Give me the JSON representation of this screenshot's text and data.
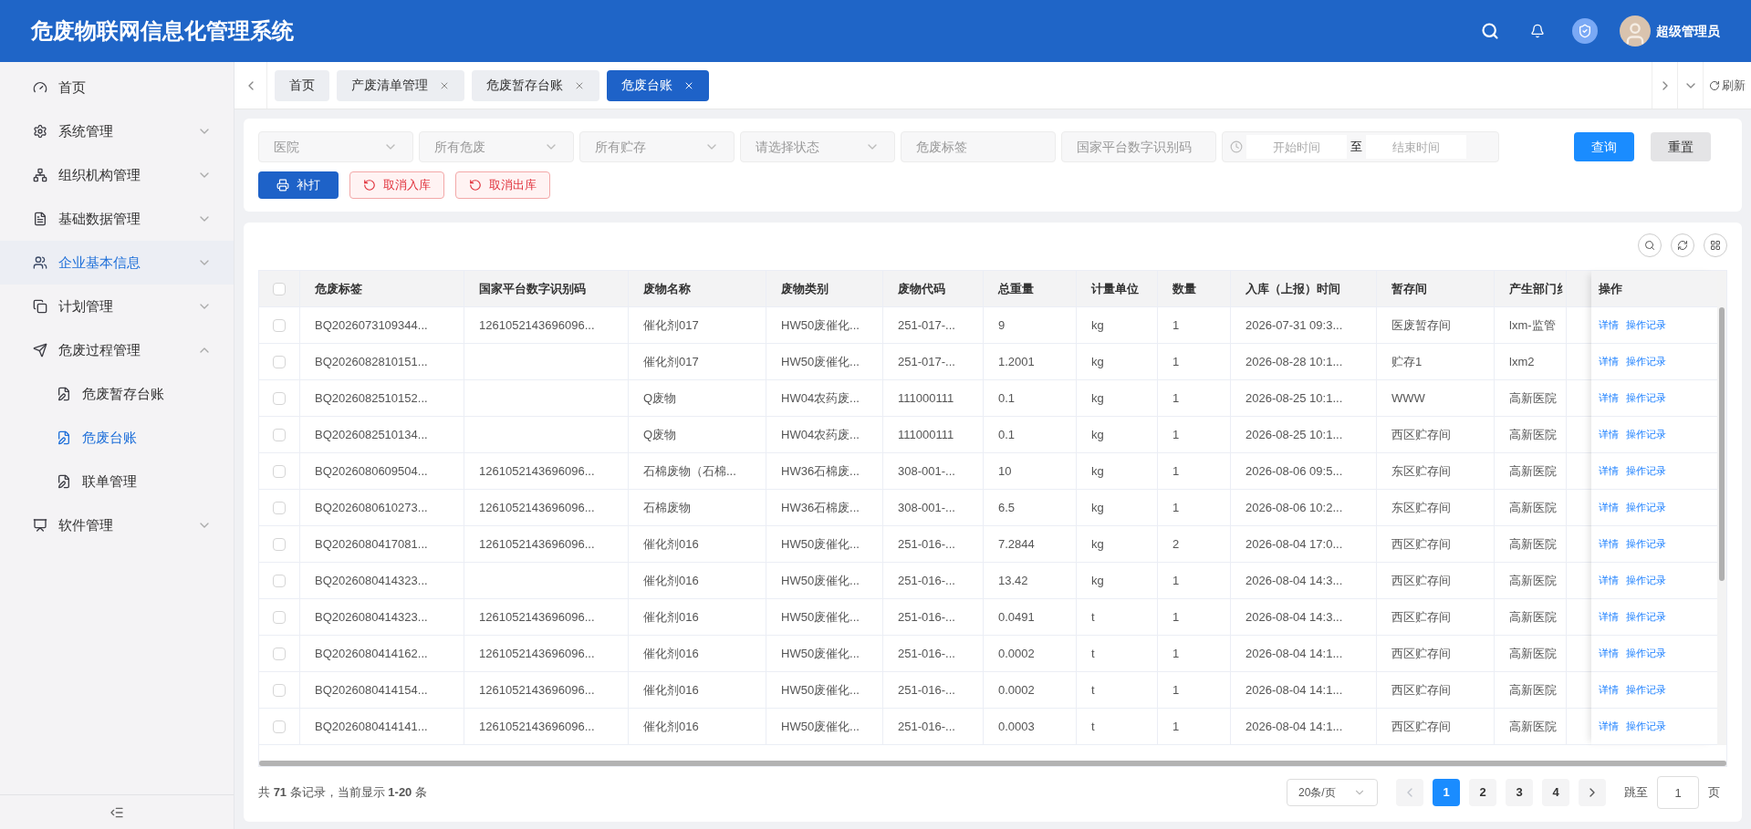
{
  "header": {
    "title": "危废物联网信息化管理系统",
    "user": "超级管理员"
  },
  "sidebar": {
    "items": [
      {
        "label": "首页",
        "kind": "link",
        "highlighted": false
      },
      {
        "label": "系统管理",
        "kind": "group",
        "expanded": false,
        "highlighted": false
      },
      {
        "label": "组织机构管理",
        "kind": "group",
        "expanded": false,
        "highlighted": false
      },
      {
        "label": "基础数据管理",
        "kind": "group",
        "expanded": false,
        "highlighted": false
      },
      {
        "label": "企业基本信息",
        "kind": "group",
        "expanded": false,
        "highlighted": true
      },
      {
        "label": "计划管理",
        "kind": "group",
        "expanded": false,
        "highlighted": false
      },
      {
        "label": "危废过程管理",
        "kind": "group",
        "expanded": true,
        "highlighted": false,
        "children": [
          {
            "label": "危废暂存台账",
            "selected": false
          },
          {
            "label": "危废台账",
            "selected": true
          },
          {
            "label": "联单管理",
            "selected": false
          }
        ]
      },
      {
        "label": "软件管理",
        "kind": "group",
        "expanded": false,
        "highlighted": false
      }
    ]
  },
  "tabs": [
    {
      "label": "首页",
      "selected": false,
      "closable": false
    },
    {
      "label": "产废清单管理",
      "selected": false,
      "closable": true
    },
    {
      "label": "危废暂存台账",
      "selected": false,
      "closable": true
    },
    {
      "label": "危废台账",
      "selected": true,
      "closable": true
    }
  ],
  "tabs_refresh": "刷新",
  "filters": [
    {
      "kind": "select",
      "placeholder": "医院"
    },
    {
      "kind": "select",
      "placeholder": "所有危废"
    },
    {
      "kind": "select",
      "placeholder": "所有贮存"
    },
    {
      "kind": "select",
      "placeholder": "请选择状态"
    },
    {
      "kind": "input",
      "placeholder": "危废标签"
    },
    {
      "kind": "input",
      "placeholder": "国家平台数字识别码"
    }
  ],
  "date_range": {
    "start_placeholder": "开始时间",
    "separator": "至",
    "end_placeholder": "结束时间"
  },
  "search_buttons": [
    {
      "label": "查询",
      "kind": "primary"
    },
    {
      "label": "重置",
      "kind": "default"
    }
  ],
  "action_buttons": [
    {
      "label": "补打",
      "kind": "primary"
    },
    {
      "label": "取消入库",
      "kind": "danger"
    },
    {
      "label": "取消出库",
      "kind": "danger"
    }
  ],
  "table": {
    "all_checked": false,
    "columns": [
      "危废标签",
      "国家平台数字识别码",
      "废物名称",
      "废物类别",
      "废物代码",
      "总重量",
      "计量单位",
      "数量",
      "入库（上报）时间",
      "暂存间",
      "产生部门纟"
    ],
    "action_column": "操作",
    "rows": [
      {
        "checked": false,
        "cells": [
          "BQ2026073109344...",
          "1261052143696096...",
          "催化剂017",
          "HW50废催化...",
          "251-017-...",
          "9",
          "kg",
          "1",
          "2026-07-31 09:3...",
          "医废暂存间",
          "lxm-监管"
        ],
        "actions": [
          "详情",
          "操作记录"
        ]
      },
      {
        "checked": false,
        "cells": [
          "BQ2026082810151...",
          null,
          "催化剂017",
          "HW50废催化...",
          "251-017-...",
          "1.2001",
          "kg",
          "1",
          "2026-08-28 10:1...",
          "贮存1",
          "lxm2"
        ],
        "actions": [
          "详情",
          "操作记录"
        ]
      },
      {
        "checked": false,
        "cells": [
          "BQ2026082510152...",
          null,
          "Q废物",
          "HW04农药废...",
          "111000111",
          "0.1",
          "kg",
          "1",
          "2026-08-25 10:1...",
          "WWW",
          "高新医院"
        ],
        "actions": [
          "详情",
          "操作记录"
        ]
      },
      {
        "checked": false,
        "cells": [
          "BQ2026082510134...",
          null,
          "Q废物",
          "HW04农药废...",
          "111000111",
          "0.1",
          "kg",
          "1",
          "2026-08-25 10:1...",
          "西区贮存间",
          "高新医院"
        ],
        "actions": [
          "详情",
          "操作记录"
        ]
      },
      {
        "checked": false,
        "cells": [
          "BQ2026080609504...",
          "1261052143696096...",
          "石棉废物（石棉...",
          "HW36石棉废...",
          "308-001-...",
          "10",
          "kg",
          "1",
          "2026-08-06 09:5...",
          "东区贮存间",
          "高新医院"
        ],
        "actions": [
          "详情",
          "操作记录"
        ]
      },
      {
        "checked": false,
        "cells": [
          "BQ2026080610273...",
          "1261052143696096...",
          "石棉废物",
          "HW36石棉废...",
          "308-001-...",
          "6.5",
          "kg",
          "1",
          "2026-08-06 10:2...",
          "东区贮存间",
          "高新医院"
        ],
        "actions": [
          "详情",
          "操作记录"
        ]
      },
      {
        "checked": false,
        "cells": [
          "BQ2026080417081...",
          "1261052143696096...",
          "催化剂016",
          "HW50废催化...",
          "251-016-...",
          "7.2844",
          "kg",
          "2",
          "2026-08-04 17:0...",
          "西区贮存间",
          "高新医院"
        ],
        "actions": [
          "详情",
          "操作记录"
        ]
      },
      {
        "checked": false,
        "cells": [
          "BQ2026080414323...",
          null,
          "催化剂016",
          "HW50废催化...",
          "251-016-...",
          "13.42",
          "kg",
          "1",
          "2026-08-04 14:3...",
          "西区贮存间",
          "高新医院"
        ],
        "actions": [
          "详情",
          "操作记录"
        ]
      },
      {
        "checked": false,
        "cells": [
          "BQ2026080414323...",
          "1261052143696096...",
          "催化剂016",
          "HW50废催化...",
          "251-016-...",
          "0.0491",
          "t",
          "1",
          "2026-08-04 14:3...",
          "西区贮存间",
          "高新医院"
        ],
        "actions": [
          "详情",
          "操作记录"
        ]
      },
      {
        "checked": false,
        "cells": [
          "BQ2026080414162...",
          "1261052143696096...",
          "催化剂016",
          "HW50废催化...",
          "251-016-...",
          "0.0002",
          "t",
          "1",
          "2026-08-04 14:1...",
          "西区贮存间",
          "高新医院"
        ],
        "actions": [
          "详情",
          "操作记录"
        ]
      },
      {
        "checked": false,
        "cells": [
          "BQ2026080414154...",
          "1261052143696096...",
          "催化剂016",
          "HW50废催化...",
          "251-016-...",
          "0.0002",
          "t",
          "1",
          "2026-08-04 14:1...",
          "西区贮存间",
          "高新医院"
        ],
        "actions": [
          "详情",
          "操作记录"
        ]
      },
      {
        "checked": false,
        "cells": [
          "BQ2026080414141...",
          "1261052143696096...",
          "催化剂016",
          "HW50废催化...",
          "251-016-...",
          "0.0003",
          "t",
          "1",
          "2026-08-04 14:1...",
          "西区贮存间",
          "高新医院"
        ],
        "actions": [
          "详情",
          "操作记录"
        ]
      }
    ]
  },
  "pagination": {
    "summary": "共 **71** 条记录，当前显示 **1-20** 条",
    "page_size": "20条/页",
    "pages": [
      {
        "label": "1",
        "selected": true
      },
      {
        "label": "2",
        "selected": false
      },
      {
        "label": "3",
        "selected": false
      },
      {
        "label": "4",
        "selected": false
      }
    ],
    "jump_label": "跳至",
    "jump_value": "1",
    "jump_unit": "页"
  }
}
